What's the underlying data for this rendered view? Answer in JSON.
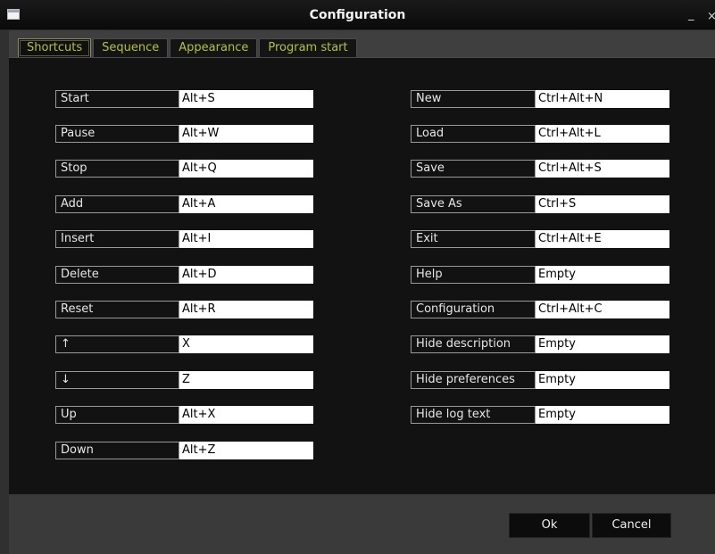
{
  "window": {
    "title": "Configuration",
    "minimize": "_",
    "close": "×"
  },
  "tabs": [
    {
      "label": "Shortcuts",
      "active": true
    },
    {
      "label": "Sequence",
      "active": false
    },
    {
      "label": "Appearance",
      "active": false
    },
    {
      "label": "Program start",
      "active": false
    }
  ],
  "shortcuts_left": [
    {
      "label": "Start",
      "value": "Alt+S"
    },
    {
      "label": "Pause",
      "value": "Alt+W"
    },
    {
      "label": "Stop",
      "value": "Alt+Q"
    },
    {
      "label": "Add",
      "value": "Alt+A"
    },
    {
      "label": "Insert",
      "value": "Alt+I"
    },
    {
      "label": "Delete",
      "value": "Alt+D"
    },
    {
      "label": "Reset",
      "value": "Alt+R"
    },
    {
      "label": "↑",
      "value": "X"
    },
    {
      "label": "↓",
      "value": "Z"
    },
    {
      "label": "Up",
      "value": "Alt+X"
    },
    {
      "label": "Down",
      "value": "Alt+Z"
    }
  ],
  "shortcuts_right": [
    {
      "label": "New",
      "value": "Ctrl+Alt+N"
    },
    {
      "label": "Load",
      "value": "Ctrl+Alt+L"
    },
    {
      "label": "Save",
      "value": "Ctrl+Alt+S"
    },
    {
      "label": "Save As",
      "value": "Ctrl+S"
    },
    {
      "label": "Exit",
      "value": "Ctrl+Alt+E"
    },
    {
      "label": "Help",
      "value": "Empty"
    },
    {
      "label": "Configuration",
      "value": "Ctrl+Alt+C"
    },
    {
      "label": "Hide description",
      "value": "Empty"
    },
    {
      "label": "Hide preferences",
      "value": "Empty"
    },
    {
      "label": "Hide log text",
      "value": "Empty"
    }
  ],
  "buttons": {
    "ok": "Ok",
    "cancel": "Cancel"
  },
  "colors": {
    "tab_text": "#b4c233",
    "panel_bg": "#121212",
    "field_bg": "#ffffff"
  }
}
